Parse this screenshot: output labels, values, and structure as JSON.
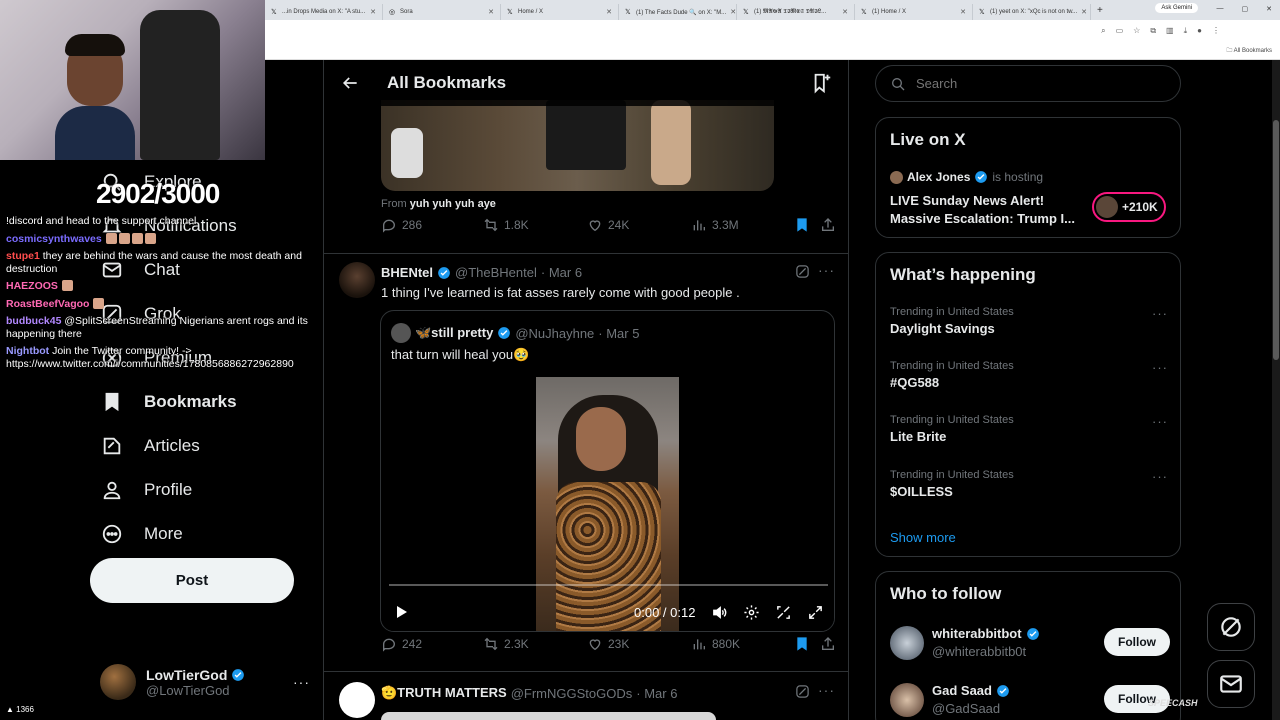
{
  "browser": {
    "tabs": [
      {
        "label": "...in Drops Media on X: \"A stu...",
        "icon": "x-logo"
      },
      {
        "label": "Sora",
        "icon": "sora-icon"
      },
      {
        "label": "Home / X",
        "icon": "x-logo"
      },
      {
        "label": "(1) The Facts Dude 🔍 on X: \"M...",
        "icon": "x-logo"
      },
      {
        "label": "(1) 𝕸𝕬𝕲𝕬 𝕿𝕴𝕸𝕰𝕾 𝕯𝕬𝕴𝕷...",
        "icon": "x-logo",
        "active": true
      },
      {
        "label": "(1) Home / X",
        "icon": "x-logo"
      },
      {
        "label": "(1) yeet on X: \"xQc is not on tw...",
        "icon": "x-logo"
      }
    ],
    "gemini_label": "Ask Gemini",
    "all_bookmarks": "All Bookmarks"
  },
  "stream": {
    "counter": "2902/3000",
    "viewers": "1366",
    "chat": [
      {
        "user": "",
        "text": "!discord and head to the support channel",
        "color": "#ffffff"
      },
      {
        "user": "cosmicsynthwaves",
        "text": "",
        "color": "#7b6cff",
        "emotes": 4
      },
      {
        "user": "stupe1",
        "text": "they are behind the wars and cause the most death and destruction",
        "color": "#ff4d4d"
      },
      {
        "user": "HAEZOOS",
        "text": "",
        "color": "#ff69b4",
        "emotes": 1
      },
      {
        "user": "RoastBeefVagoo",
        "text": "",
        "color": "#ff69b4",
        "emotes": 1
      },
      {
        "user": "budbuck45",
        "text": "@SplitScreenStreaming Nigerians arent rogs and its happening there",
        "color": "#b288ff"
      },
      {
        "user": "Nightbot",
        "text": "Join the Twitter community! -> https://www.twitter.com/i/communities/1780856886272962890",
        "color": "#9a9aff"
      }
    ]
  },
  "nav": {
    "items": [
      {
        "label": "Explore",
        "icon": "search-icon"
      },
      {
        "label": "Notifications",
        "icon": "bell-icon",
        "badge": "1"
      },
      {
        "label": "Chat",
        "icon": "mail-icon"
      },
      {
        "label": "Grok",
        "icon": "grok-icon"
      },
      {
        "label": "Premium",
        "icon": "x-logo-icon"
      },
      {
        "label": "Bookmarks",
        "icon": "bookmark-icon"
      },
      {
        "label": "Articles",
        "icon": "article-icon"
      },
      {
        "label": "Profile",
        "icon": "person-icon"
      },
      {
        "label": "More",
        "icon": "more-circle-icon"
      }
    ],
    "post_label": "Post",
    "account": {
      "name": "LowTierGod",
      "handle": "@LowTierGod",
      "more": "···"
    }
  },
  "main": {
    "title": "All Bookmarks",
    "prev_tweet": {
      "from_prefix": "From",
      "from_user": "yuh yuh yuh aye",
      "replies": "286",
      "reposts": "1.8K",
      "likes": "24K",
      "views": "3.3M"
    },
    "tweet": {
      "name": "BHENtel",
      "handle": "@TheBHentel",
      "date": "· Mar 6",
      "text": "1 thing I've learned is fat asses rarely come with good people .",
      "quote": {
        "name": "🦋still pretty",
        "handle": "@NuJhayhne",
        "date": "· Mar 5",
        "text": "that turn will heal you🥹",
        "video_time": "0:00 / 0:12",
        "progress": 0.0
      },
      "replies": "242",
      "reposts": "2.3K",
      "likes": "23K",
      "views": "880K"
    },
    "next_tweet": {
      "name": "🫡TRUTH MATTERS",
      "handle": "@FrmNGGStoGODs",
      "date": "· Mar 6"
    }
  },
  "sidebar": {
    "search_placeholder": "Search",
    "live": {
      "title": "Live on X",
      "host_name": "Alex Jones",
      "host_suffix": "is hosting",
      "space_title": "LIVE Sunday News Alert! Massive Escalation: Trump I...",
      "listeners": "+210K"
    },
    "happening": {
      "title": "What’s happening",
      "trends": [
        {
          "sub": "Trending in United States",
          "name": "Daylight Savings"
        },
        {
          "sub": "Trending in United States",
          "name": "#QG588"
        },
        {
          "sub": "Trending in United States",
          "name": "Lite Brite"
        },
        {
          "sub": "Trending in United States",
          "name": "$OILLESS"
        }
      ],
      "show_more": "Show more"
    },
    "who_to_follow": {
      "title": "Who to follow",
      "accounts": [
        {
          "name": "whiterabbitbot",
          "handle": "@whiterabbitb0t",
          "button": "Follow"
        },
        {
          "name": "Gad Saad",
          "handle": "@GadSaad",
          "button": "Follow"
        }
      ]
    }
  },
  "watermark": "SPEECASH",
  "colors": {
    "accent": "#1d9bf0",
    "pink": "#f91880",
    "bg": "#000000",
    "muted": "#71767b"
  }
}
